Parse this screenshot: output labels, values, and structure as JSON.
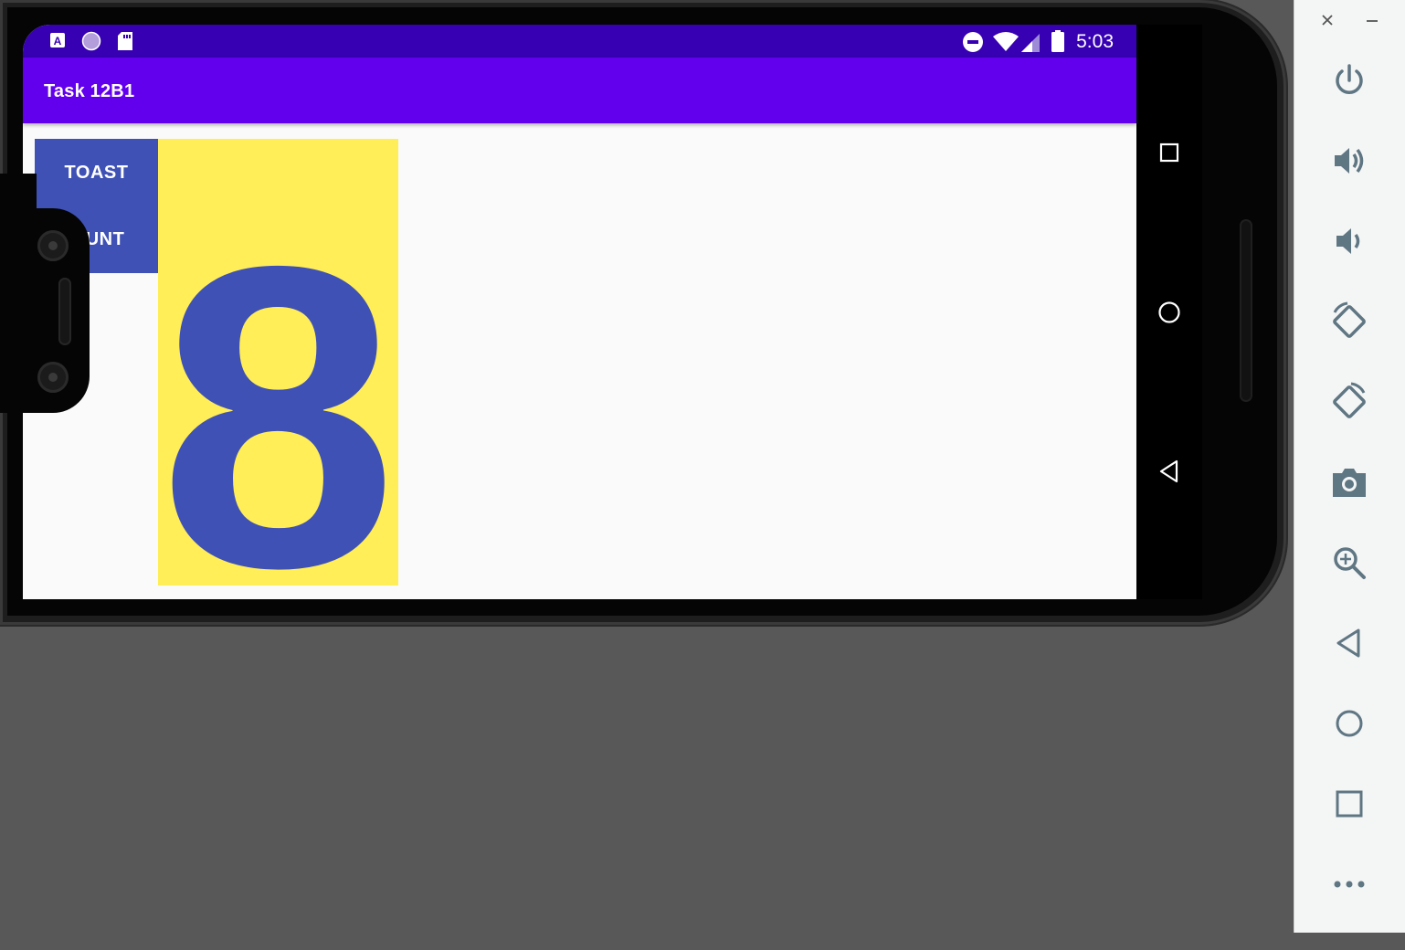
{
  "status_bar": {
    "time": "5:03",
    "icons": [
      "app-a-icon",
      "circle-notification-icon",
      "sd-card-icon",
      "do-not-disturb-icon",
      "wifi-icon",
      "signal-icon",
      "battery-icon"
    ]
  },
  "app_bar": {
    "title": "Task 12B1"
  },
  "buttons": {
    "toast_label": "TOAST",
    "count_label": "COUNT"
  },
  "count": {
    "value": "8"
  },
  "colors": {
    "status_bar": "#3700b3",
    "app_bar": "#6200ee",
    "button": "#3f51b5",
    "count_background": "#ffee58",
    "count_text": "#3f51b5"
  },
  "nav_bar": {
    "buttons": [
      "recents-icon",
      "home-icon",
      "back-icon"
    ]
  },
  "emulator_panel": {
    "controls": [
      "power-icon",
      "volume-up-icon",
      "volume-down-icon",
      "rotate-left-icon",
      "rotate-right-icon",
      "camera-icon",
      "zoom-icon",
      "back-icon",
      "home-icon",
      "overview-icon",
      "more-icon"
    ],
    "window_controls": [
      "close-icon",
      "minimize-icon"
    ]
  }
}
